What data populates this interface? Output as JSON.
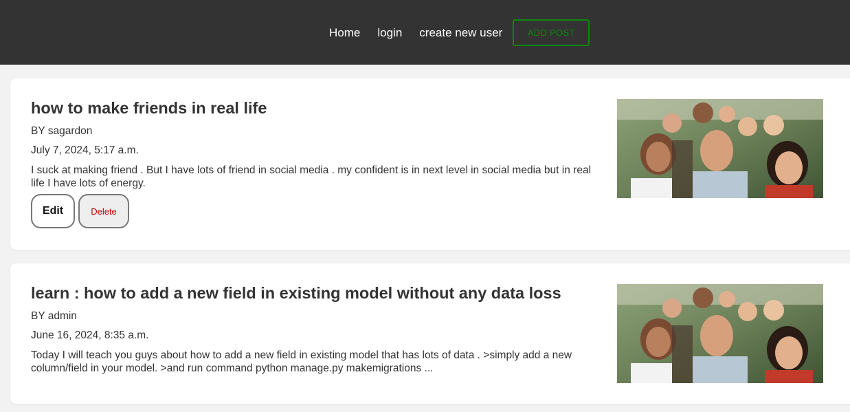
{
  "nav": {
    "home": "Home",
    "login": "login",
    "create_user": "create new user",
    "add_post": "ADD POST"
  },
  "posts": [
    {
      "title": "how to make friends in real life",
      "author": "BY sagardon",
      "date": "July 7, 2024, 5:17 a.m.",
      "excerpt": "I suck at making friend . But I have lots of friend in social media . my confident is in next level in social media but in real life I have lots of energy.",
      "edit_label": "Edit",
      "delete_label": "Delete"
    },
    {
      "title": "learn : how to add a new field in existing model without any data loss",
      "author": "BY admin",
      "date": "June 16, 2024, 8:35 a.m.",
      "excerpt": "Today I will teach you guys about how to add a new field in existing model that has lots of data . >simply add a new column/field in your model. >and run command python manage.py makemigrations ..."
    }
  ],
  "colors": {
    "topbar": "#333333",
    "accent_green": "#0a8a0a",
    "delete_red": "#c00000"
  }
}
